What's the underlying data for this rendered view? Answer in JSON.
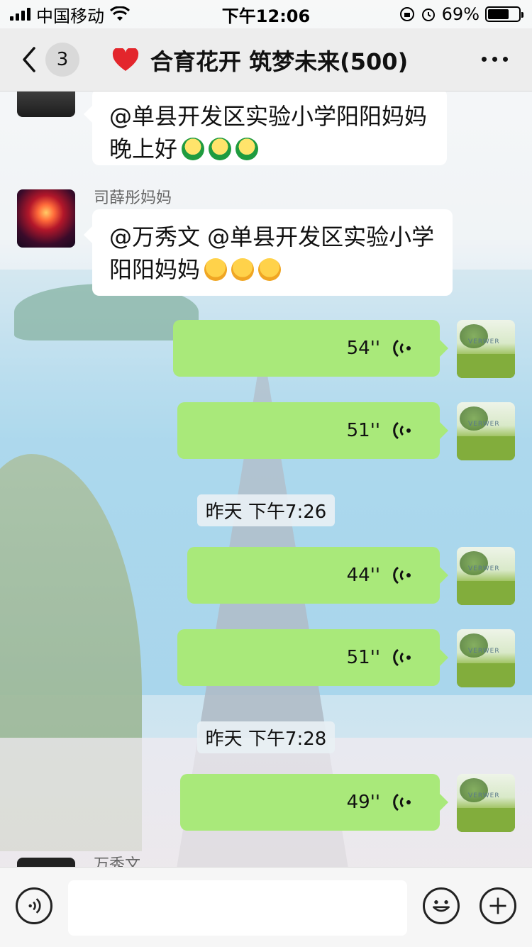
{
  "status_bar": {
    "carrier": "中国移动",
    "time": "下午12:06",
    "battery": "69%",
    "battery_level": 0.69
  },
  "nav": {
    "unread_count": "3",
    "title": "合育花开 筑梦未来(500)"
  },
  "messages": [
    {
      "id": "m1",
      "text": "@单县开发区实验小学阳阳妈妈 晚上好",
      "emoji_count": 3,
      "emoji_type": "green-face-emoji"
    },
    {
      "id": "m2",
      "sender": "司薛彤妈妈",
      "text": "@万秀文 @单县开发区实验小学阳阳妈妈",
      "emoji_count": 3,
      "emoji_type": "hugging-face-emoji"
    }
  ],
  "voice_messages": [
    {
      "duration": "54''"
    },
    {
      "duration": "51''"
    },
    {
      "duration": "44''"
    },
    {
      "duration": "51''"
    },
    {
      "duration": "49''"
    }
  ],
  "timestamps": [
    "昨天 下午7:26",
    "昨天 下午7:28"
  ],
  "next_sender": "万秀文",
  "input": {
    "voice_icon": "voice-mode-icon",
    "emoji_icon": "emoji-icon",
    "plus_icon": "plus-icon"
  }
}
